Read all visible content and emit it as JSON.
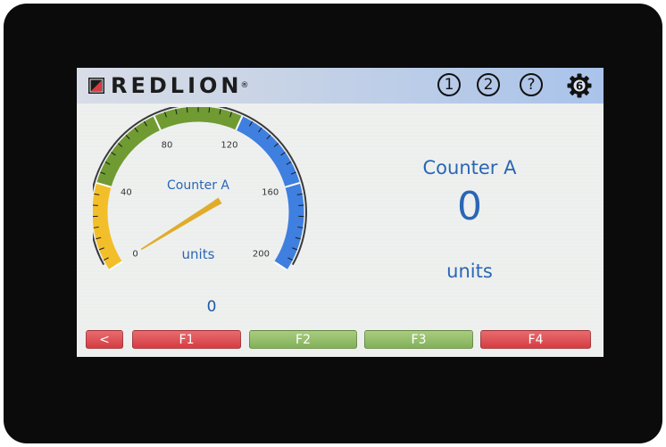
{
  "header": {
    "logo_text": "REDLION",
    "logo_mark": "®",
    "buttons": [
      {
        "label": "1",
        "icon": "circle-1-icon"
      },
      {
        "label": "2",
        "icon": "circle-2-icon"
      },
      {
        "label": "?",
        "icon": "help-icon"
      },
      {
        "label": "6",
        "icon": "gear-icon"
      }
    ]
  },
  "gauge": {
    "title": "Counter A",
    "units": "units",
    "value_text": "0",
    "value": 0,
    "min": 0,
    "max": 200,
    "tick_labels": [
      "0",
      "40",
      "80",
      "120",
      "160",
      "200"
    ],
    "bands": [
      {
        "from": 0,
        "to": 40,
        "color": "#f2bf2a"
      },
      {
        "from": 40,
        "to": 120,
        "color": "#6f9b32"
      },
      {
        "from": 120,
        "to": 200,
        "color": "#3f7fe0"
      }
    ],
    "needle_color": "#e0ac2a"
  },
  "readout": {
    "title": "Counter A",
    "value": "0",
    "units": "units"
  },
  "function_keys": [
    {
      "label": "<",
      "color": "red"
    },
    {
      "label": "F1",
      "color": "red"
    },
    {
      "label": "F2",
      "color": "green"
    },
    {
      "label": "F3",
      "color": "green"
    },
    {
      "label": "F4",
      "color": "red"
    }
  ]
}
